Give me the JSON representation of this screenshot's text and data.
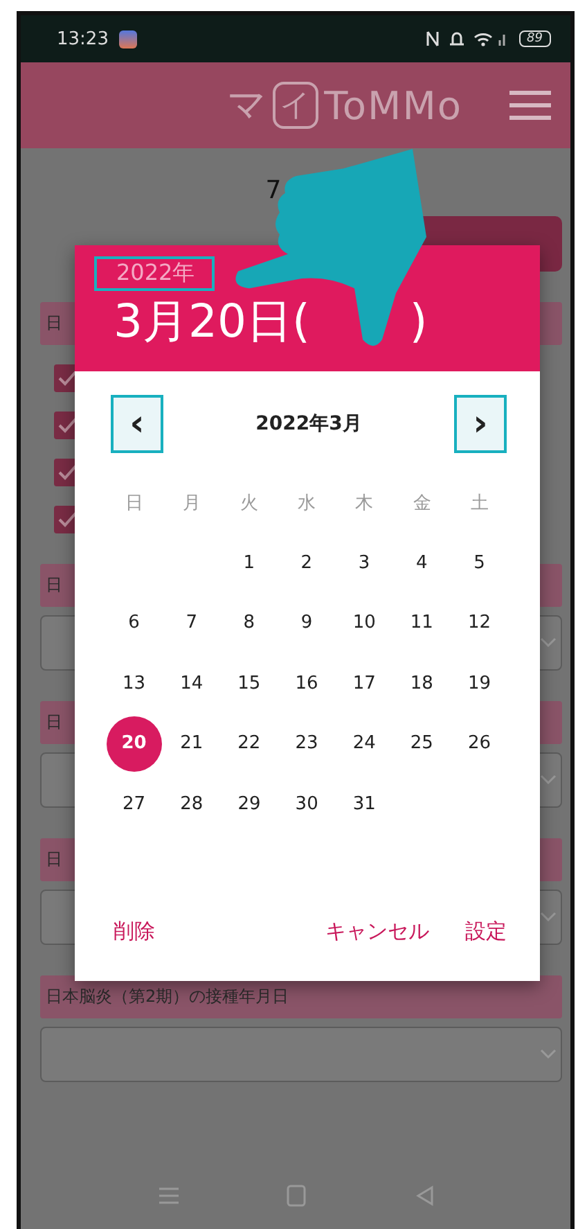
{
  "status_bar": {
    "time": "13:23",
    "battery": "89"
  },
  "header": {
    "logo": {
      "prefix": "マ",
      "mark": "イ",
      "name": "ToMMo"
    }
  },
  "page": {
    "title": "7",
    "sections": [
      {
        "label": "日",
        "kind": "checklist",
        "checkboxes": [
          {
            "checked": true
          },
          {
            "checked": true
          },
          {
            "checked": true
          },
          {
            "checked": true
          }
        ]
      },
      {
        "label": "日",
        "kind": "select"
      },
      {
        "label": "日",
        "kind": "select"
      },
      {
        "label": "日",
        "kind": "select"
      },
      {
        "label": "日本脳炎（第2期）の接種年月日",
        "kind": "select"
      }
    ]
  },
  "date_picker": {
    "year": "2022年",
    "date": "3月20日(",
    "date_end": ")",
    "month": "2022年3月",
    "prev": "‹",
    "next": "›",
    "weekdays": [
      "日",
      "月",
      "火",
      "水",
      "木",
      "金",
      "土"
    ],
    "weeks": [
      {
        "kind": "first",
        "days": [
          {
            "label": "1",
            "selected": false
          },
          {
            "label": "2",
            "selected": false
          },
          {
            "label": "3",
            "selected": false
          },
          {
            "label": "4",
            "selected": false
          },
          {
            "label": "5",
            "selected": false
          }
        ]
      },
      {
        "kind": "full",
        "days": [
          {
            "label": "6",
            "selected": false
          },
          {
            "label": "7",
            "selected": false
          },
          {
            "label": "8",
            "selected": false
          },
          {
            "label": "9",
            "selected": false
          },
          {
            "label": "10",
            "selected": false
          },
          {
            "label": "11",
            "selected": false
          },
          {
            "label": "12",
            "selected": false
          }
        ]
      },
      {
        "kind": "full",
        "days": [
          {
            "label": "13",
            "selected": false
          },
          {
            "label": "14",
            "selected": false
          },
          {
            "label": "15",
            "selected": false
          },
          {
            "label": "16",
            "selected": false
          },
          {
            "label": "17",
            "selected": false
          },
          {
            "label": "18",
            "selected": false
          },
          {
            "label": "19",
            "selected": false
          }
        ]
      },
      {
        "kind": "full",
        "days": [
          {
            "label": "20",
            "selected": true
          },
          {
            "label": "21",
            "selected": false
          },
          {
            "label": "22",
            "selected": false
          },
          {
            "label": "23",
            "selected": false
          },
          {
            "label": "24",
            "selected": false
          },
          {
            "label": "25",
            "selected": false
          },
          {
            "label": "26",
            "selected": false
          }
        ]
      },
      {
        "kind": "last",
        "days": [
          {
            "label": "27",
            "selected": false
          },
          {
            "label": "28",
            "selected": false
          },
          {
            "label": "29",
            "selected": false
          },
          {
            "label": "30",
            "selected": false
          },
          {
            "label": "31",
            "selected": false
          }
        ]
      }
    ],
    "buttons": {
      "delete": "削除",
      "cancel": "キャンセル",
      "ok": "設定"
    }
  }
}
